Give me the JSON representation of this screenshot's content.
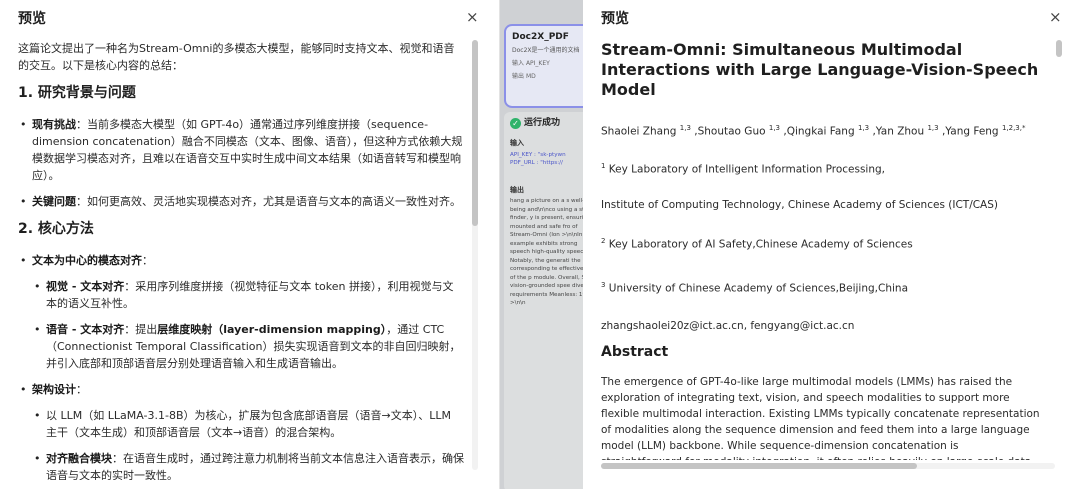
{
  "left_panel": {
    "title": "预览",
    "close": "×",
    "intro": "这篇论文提出了一种名为Stream-Omni的多模态大模型，能够同时支持文本、视觉和语音的交互。以下是核心内容的总结：",
    "sections": [
      {
        "heading": "1. 研究背景与问题",
        "items": [
          {
            "label": "现有挑战",
            "text": "：当前多模态大模型（如 GPT-4o）通常通过序列维度拼接（sequence-dimension concatenation）融合不同模态（文本、图像、语音），但这种方式依赖大规模数据学习模态对齐，且难以在语音交互中实时生成中间文本结果（如语音转写和模型响应）。"
          },
          {
            "label": "关键问题",
            "text": "：如何更高效、灵活地实现模态对齐，尤其是语音与文本的高语义一致性对齐。"
          }
        ]
      },
      {
        "heading": "2. 核心方法",
        "group": {
          "label": "文本为中心的模态对齐",
          "text": "："
        },
        "sub_items": [
          {
            "label": "视觉 - 文本对齐",
            "text": "：采用序列维度拼接（视觉特征与文本 token 拼接），利用视觉与文本的语义互补性。"
          },
          {
            "label": "语音 - 文本对齐",
            "text_a": "：提出",
            "label2": "层维度映射（layer-dimension mapping）",
            "text_b": "，通过 CTC（Connectionist Temporal Classification）损失实现语音到文本的非自回归映射，并引入底部和顶部语音层分别处理语音输入和生成语音输出。"
          }
        ],
        "group2": {
          "label": "架构设计",
          "text": "："
        },
        "sub_items2": [
          {
            "label": "",
            "text": "以 LLM（如 LLaMA-3.1-8B）为核心，扩展为包含底部语音层（语音→文本）、LLM 主干（文本生成）和顶部语音层（文本→语音）的混合架构。"
          },
          {
            "label": "对齐融合模块",
            "text": "：在语音生成时，通过跨注意力机制将当前文本信息注入语音表示，确保语音与文本的实时一致性。"
          }
        ]
      }
    ]
  },
  "middle": {
    "card_title": "Doc2X_PDF",
    "card_desc": "Doc2X是一个通用的文档",
    "input_label": "输入",
    "input_key": "API_KEY",
    "output_label": "输出",
    "output_val": "MD",
    "result_status": "运行成功",
    "input_section": "输入",
    "kv1": "API_KEY : \"sk-ptywn",
    "kv2": "PDF_URL : \"https://",
    "output_section": "输出",
    "output_text": "hang a picture on a s well-being and\\n\\nco using a stud finder, y is present, ensuring t mounted and safe fro of Stream-Omni (lon >\\n\\nIn the example exhibits strong speech high-quality speech Notably, the generati the corresponding te effectiveness of the p module. Overall, Strea vision-grounded spee diverse requirements Meanless: 19-->\\n\\n"
  },
  "right_panel": {
    "title": "预览",
    "close": "×",
    "doc_title": "Stream-Omni: Simultaneous Multimodal Interactions with Large Language-Vision-Speech Model",
    "authors": [
      {
        "name": "Shaolei Zhang",
        "sup": "1,3",
        "sep": ""
      },
      {
        "name": "Shoutao Guo",
        "sup": "1,3",
        "sep": " ,"
      },
      {
        "name": "Qingkai Fang",
        "sup": "1,3",
        "sep": " ,"
      },
      {
        "name": "Yan Zhou",
        "sup": "1,3",
        "sep": " ,"
      },
      {
        "name": "Yang Feng",
        "sup": "1,2,3,*",
        "sep": " ,"
      }
    ],
    "affil1_sup": "1",
    "affil1": " Key Laboratory of Intelligent Information Processing,",
    "affil1b": "Institute of Computing Technology, Chinese Academy of Sciences (ICT/CAS)",
    "affil2_sup": "2",
    "affil2": " Key Laboratory of AI Safety,Chinese Academy of Sciences",
    "affil3_sup": "3",
    "affil3": " University of Chinese Academy of Sciences,Beijing,China",
    "emails": "zhangshaolei20z@ict.ac.cn, fengyang@ict.ac.cn",
    "abstract_heading": "Abstract",
    "abstract_text": "The emergence of GPT-4o-like large multimodal models (LMMs) has raised the exploration of integrating text, vision, and speech modalities to support more flexible multimodal interaction. Existing LMMs typically concatenate representation of modalities along the sequence dimension and feed them into a large language model (LLM) backbone. While sequence-dimension concatenation is straightforward for modality integration, it often relies heavily on large-scale data to learn modality"
  }
}
